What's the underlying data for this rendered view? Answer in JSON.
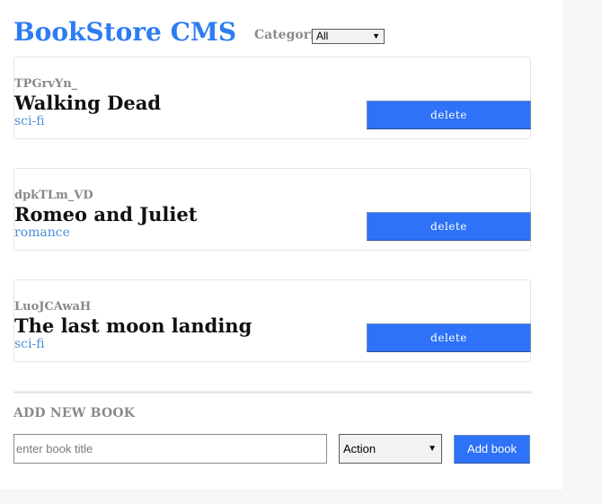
{
  "header": {
    "title": "BookStore CMS",
    "categories_label": "Categories",
    "categories_selected": "All"
  },
  "books": [
    {
      "id": "TPGrvYn_",
      "title": "Walking Dead",
      "category": "sci-fi",
      "delete_label": "delete"
    },
    {
      "id": "dpkTLm_VD",
      "title": "Romeo and Juliet",
      "category": "romance",
      "delete_label": "delete"
    },
    {
      "id": "LuoJCAwaH",
      "title": "The last moon landing",
      "category": "sci-fi",
      "delete_label": "delete"
    }
  ],
  "add_form": {
    "heading": "ADD NEW BOOK",
    "title_placeholder": "enter book title",
    "title_value": "",
    "genre_selected": "Action",
    "submit_label": "Add book"
  },
  "colors": {
    "brand": "#2d7cf2",
    "button": "#2d72f7",
    "category_link": "#4a90d9"
  },
  "icons": {
    "dropdown": "chevron-down-icon"
  }
}
